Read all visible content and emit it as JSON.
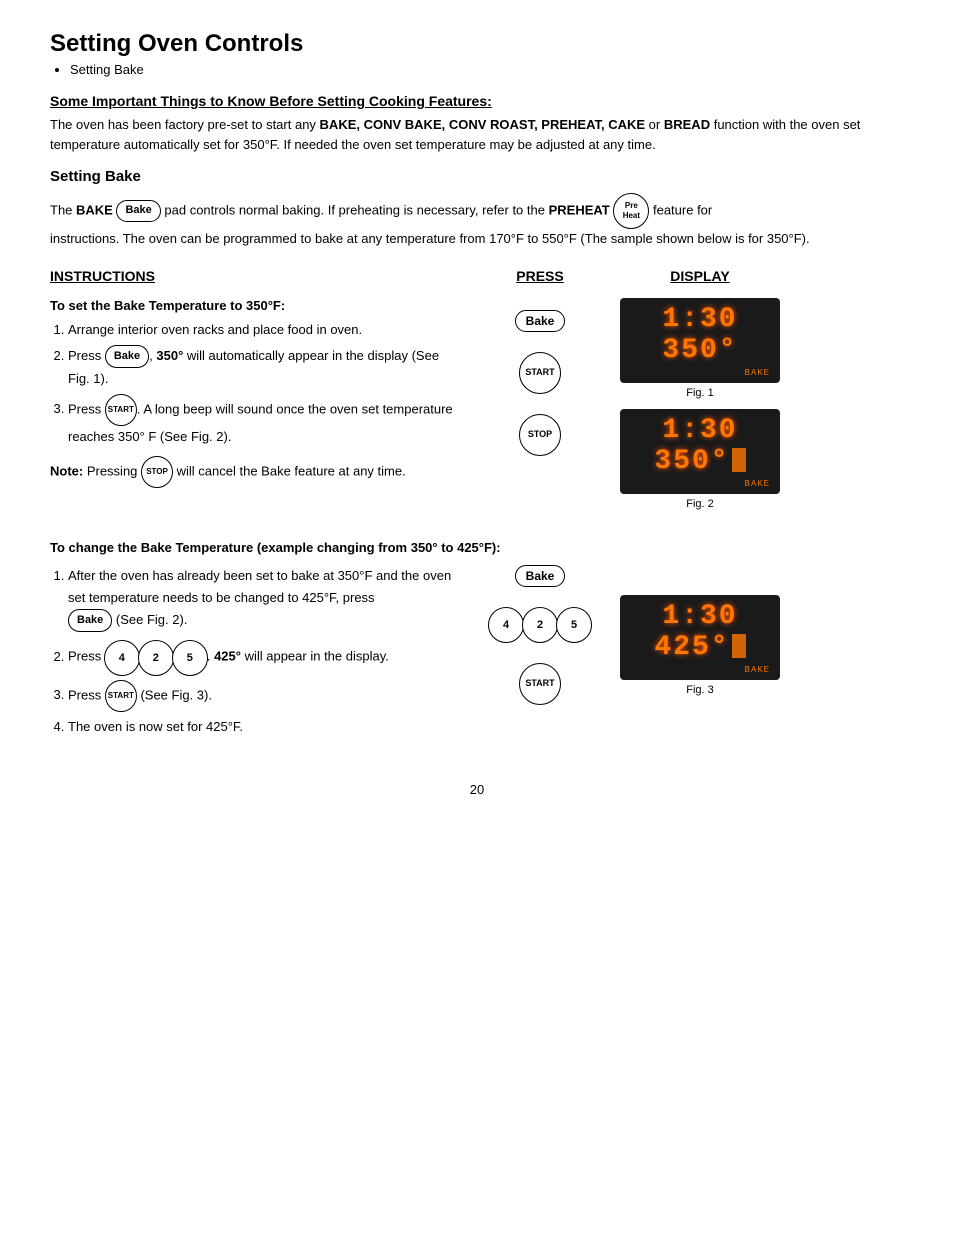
{
  "page": {
    "title": "Setting Oven Controls",
    "bullet": "Setting Bake",
    "page_number": "20",
    "important_heading": "Some Important Things to Know Before Setting Cooking Features:",
    "important_text_prefix": "The oven has been factory pre-set to start any ",
    "important_bold_items": "BAKE, CONV BAKE, CONV ROAST, PREHEAT, CAKE",
    "important_text_mid": " or ",
    "important_bold_bread": "BREAD",
    "important_text_suffix": " function with the oven set temperature automatically set for 350°F. If needed the oven set temperature may be adjusted at any time.",
    "setting_bake_heading": "Setting Bake",
    "bake_intro_part1": "The ",
    "bake_intro_bold1": "BAKE",
    "bake_intro_btn1": "Bake",
    "bake_intro_part2": " pad controls normal baking. If preheating is necessary, refer to the ",
    "bake_intro_bold2": "PREHEAT",
    "bake_intro_btn2_line1": "Pre",
    "bake_intro_btn2_line2": "Heat",
    "bake_intro_part3": " feature for instructions. The oven can be programmed to bake at any temperature from 170°F to 550°F (The sample shown below is for 350°F).",
    "col_instructions": "INSTRUCTIONS",
    "col_press": "PRESS",
    "col_display": "DISPLAY",
    "task1_heading": "To set the Bake Temperature to 350°F:",
    "task1_steps": [
      "Arrange interior oven racks and place food in oven.",
      "Press {Bake}, 350° will automatically appear in the display (See Fig. 1).",
      "Press {START}. A long beep will sound once the oven set temperature reaches 350° F (See Fig. 2)."
    ],
    "task1_note_bold": "Note:",
    "task1_note_text": " Pressing {STOP} will cancel the Bake feature at any time.",
    "fig1_display": "1:30 350",
    "fig1_label": "Fig. 1",
    "fig2_display": "1:30 350",
    "fig2_label": "Fig. 2",
    "task2_heading": "To change the Bake Temperature (example changing from 350° to 425°F):",
    "task2_steps": [
      "After the oven has already been set to bake at 350°F and the oven set temperature needs to be changed to 425°F, press {Bake} (See Fig. 2).",
      "Press {4}{2}{5}. 425° will appear in the display.",
      "Press {START} (See Fig. 3).",
      "The oven is now set for 425°F."
    ],
    "fig3_display": "1:30 425",
    "fig3_label": "Fig. 3",
    "btn_bake": "Bake",
    "btn_start_top": "START",
    "btn_stop": "STOP",
    "btn_4": "4",
    "btn_2": "2",
    "btn_5": "5"
  }
}
